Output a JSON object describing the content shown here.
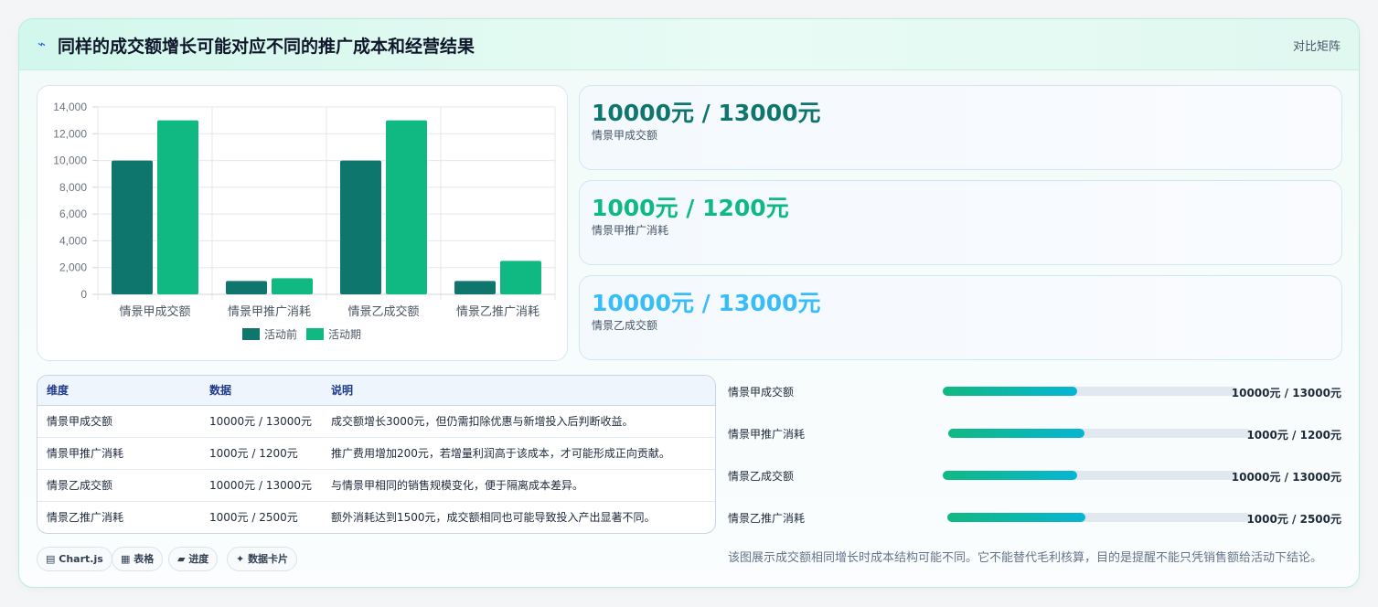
{
  "header": {
    "icon": "chart-line-icon",
    "title": "同样的成交额增长可能对应不同的推广成本和经营结果",
    "tag": "对比矩阵"
  },
  "chart_data": {
    "type": "bar",
    "categories": [
      "情景甲成交额",
      "情景甲推广消耗",
      "情景乙成交额",
      "情景乙推广消耗"
    ],
    "series": [
      {
        "name": "活动前",
        "color": "#0f766e",
        "values": [
          10000,
          1000,
          10000,
          1000
        ]
      },
      {
        "name": "活动期",
        "color": "#10b981",
        "values": [
          13000,
          1200,
          13000,
          2500
        ]
      }
    ],
    "ylim": [
      0,
      14000
    ],
    "yticks": [
      "0",
      "2,000",
      "4,000",
      "6,000",
      "8,000",
      "10,000",
      "12,000",
      "14,000"
    ],
    "grid": true,
    "legend": "bottom"
  },
  "stats": [
    {
      "value": "10000元 / 13000元",
      "label": "情景甲成交额",
      "color": "#0f766e"
    },
    {
      "value": "1000元 / 1200元",
      "label": "情景甲推广消耗",
      "color": "#10b981"
    },
    {
      "value": "10000元 / 13000元",
      "label": "情景乙成交额",
      "color": "#38bdf8"
    }
  ],
  "table": {
    "headers": [
      "维度",
      "数据",
      "说明"
    ],
    "rows": [
      [
        "情景甲成交额",
        "10000元 / 13000元",
        "成交额增长3000元，但仍需扣除优惠与新增投入后判断收益。"
      ],
      [
        "情景甲推广消耗",
        "1000元 / 1200元",
        "推广费用增加200元，若增量利润高于该成本，才可能形成正向贡献。"
      ],
      [
        "情景乙成交额",
        "10000元 / 13000元",
        "与情景甲相同的销售规模变化，便于隔离成本差异。"
      ],
      [
        "情景乙推广消耗",
        "1000元 / 2500元",
        "额外消耗达到1500元，成交额相同也可能导致投入产出显著不同。"
      ]
    ]
  },
  "progress": [
    {
      "label": "情景甲成交额",
      "value": "10000元 / 13000元",
      "fraction": 0.455
    },
    {
      "label": "情景甲推广消耗",
      "value": "1000元 / 1200元",
      "fraction": 0.45
    },
    {
      "label": "情景乙成交额",
      "value": "10000元 / 13000元",
      "fraction": 0.455
    },
    {
      "label": "情景乙推广消耗",
      "value": "1000元 / 2500元",
      "fraction": 0.455
    }
  ],
  "note": "该图展示成交额相同增长时成本结构可能不同。它不能替代毛利核算，目的是提醒不能只凭销售额给活动下结论。",
  "pills": [
    {
      "icon": "chart-icon",
      "glyph": "▤",
      "label": "Chart.js"
    },
    {
      "icon": "table-icon",
      "glyph": "▦",
      "label": "表格"
    },
    {
      "icon": "progress-icon",
      "glyph": "▰",
      "label": "进度"
    },
    {
      "icon": "sparkle-icon",
      "glyph": "✦",
      "label": "数据卡片"
    }
  ]
}
